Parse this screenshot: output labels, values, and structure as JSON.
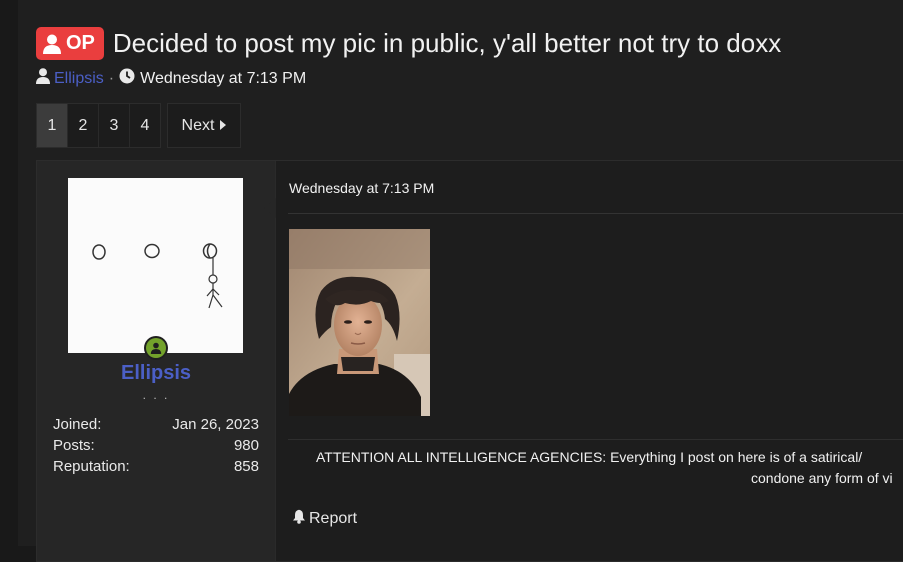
{
  "thread": {
    "op_label": "OP",
    "title": "Decided to post my pic in public, y'all better not try to doxx",
    "author": "Ellipsis",
    "separator": "·",
    "date": "Wednesday at 7:13 PM"
  },
  "pagination": {
    "pages": [
      "1",
      "2",
      "3",
      "4"
    ],
    "current": "1",
    "next_label": "Next"
  },
  "post": {
    "user": {
      "name": "Ellipsis",
      "user_title": ". . .",
      "stats": [
        {
          "label": "Joined:",
          "value": "Jan 26, 2023"
        },
        {
          "label": "Posts:",
          "value": "980"
        },
        {
          "label": "Reputation:",
          "value": "858"
        }
      ]
    },
    "date": "Wednesday at 7:13 PM",
    "signature": {
      "line1": "ATTENTION ALL INTELLIGENCE AGENCIES: Everything I post on here is of a satirical/",
      "line2": "condone any form of vi"
    },
    "report_label": "Report"
  },
  "icons": {
    "op_badge": "user-icon",
    "author": "user-icon",
    "date": "clock-icon",
    "next": "caret-right-icon",
    "online": "online-status-icon",
    "report": "bell-icon"
  },
  "colors": {
    "op_badge": "#ea3e3e",
    "username": "#4b5fc6",
    "online": "#73a22b",
    "background": "#1f1f1f"
  }
}
